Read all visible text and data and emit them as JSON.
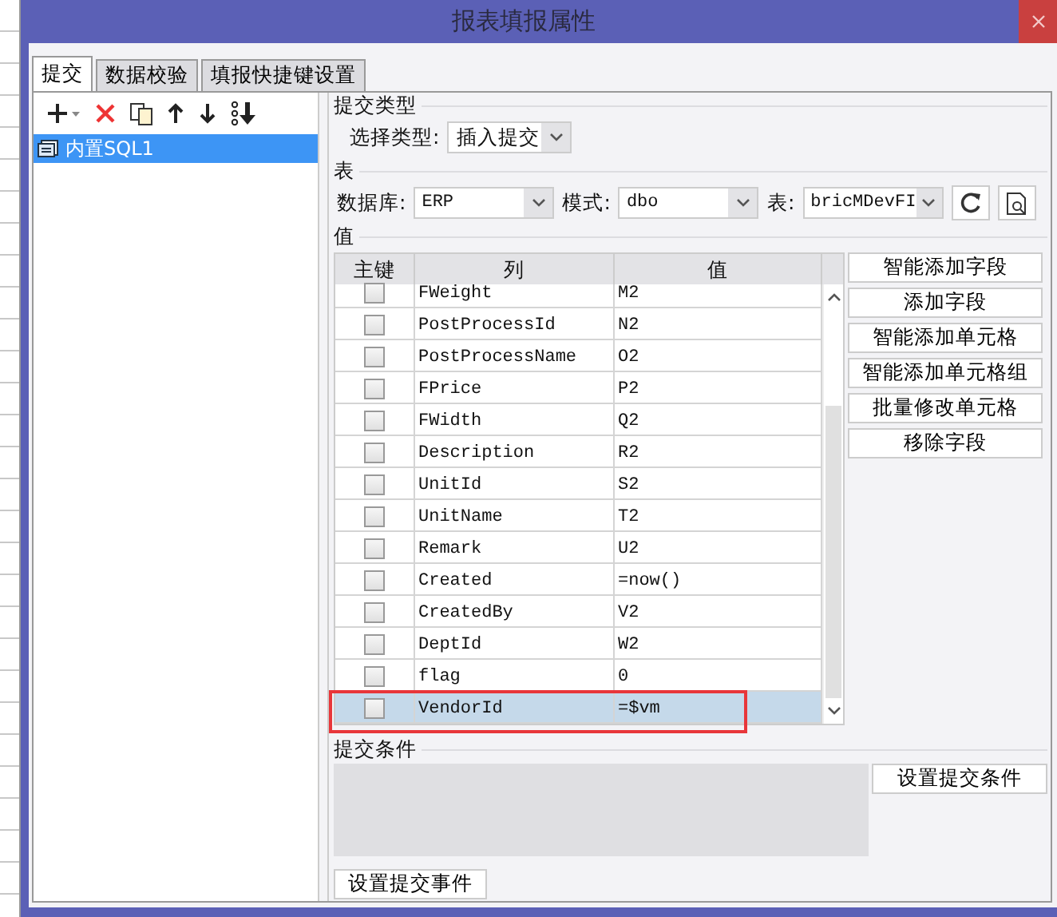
{
  "window": {
    "title": "报表填报属性"
  },
  "tabs": [
    {
      "label": "提交",
      "selected": true
    },
    {
      "label": "数据校验",
      "selected": false
    },
    {
      "label": "填报快捷键设置",
      "selected": false
    }
  ],
  "sql_list": [
    {
      "label": "内置SQL1",
      "selected": true
    }
  ],
  "submit_type": {
    "legend": "提交类型",
    "label": "选择类型:",
    "value": "插入提交"
  },
  "table_source": {
    "legend": "表",
    "database_label": "数据库:",
    "database": "ERP",
    "schema_label": "模式:",
    "schema": "dbo",
    "table_label": "表:",
    "table": "bricMDevFI"
  },
  "values": {
    "legend": "值",
    "columns": [
      "主键",
      "列",
      "值"
    ],
    "rows": [
      {
        "checked": false,
        "column": "FWeight",
        "value": "M2",
        "selected": false
      },
      {
        "checked": false,
        "column": "PostProcessId",
        "value": "N2",
        "selected": false
      },
      {
        "checked": false,
        "column": "PostProcessName",
        "value": "O2",
        "selected": false
      },
      {
        "checked": false,
        "column": "FPrice",
        "value": "P2",
        "selected": false
      },
      {
        "checked": false,
        "column": "FWidth",
        "value": "Q2",
        "selected": false
      },
      {
        "checked": false,
        "column": "Description",
        "value": "R2",
        "selected": false
      },
      {
        "checked": false,
        "column": "UnitId",
        "value": "S2",
        "selected": false
      },
      {
        "checked": false,
        "column": "UnitName",
        "value": "T2",
        "selected": false
      },
      {
        "checked": false,
        "column": "Remark",
        "value": "U2",
        "selected": false
      },
      {
        "checked": false,
        "column": "Created",
        "value": "=now()",
        "selected": false
      },
      {
        "checked": false,
        "column": "CreatedBy",
        "value": "V2",
        "selected": false
      },
      {
        "checked": false,
        "column": "DeptId",
        "value": "W2",
        "selected": false
      },
      {
        "checked": false,
        "column": "flag",
        "value": "0",
        "selected": false
      },
      {
        "checked": false,
        "column": "VendorId",
        "value": "=$vm",
        "selected": true
      }
    ],
    "buttons": [
      "智能添加字段",
      "添加字段",
      "智能添加单元格",
      "智能添加单元格组",
      "批量修改单元格",
      "移除字段"
    ]
  },
  "condition": {
    "legend": "提交条件",
    "button": "设置提交条件"
  },
  "event_button": "设置提交事件"
}
